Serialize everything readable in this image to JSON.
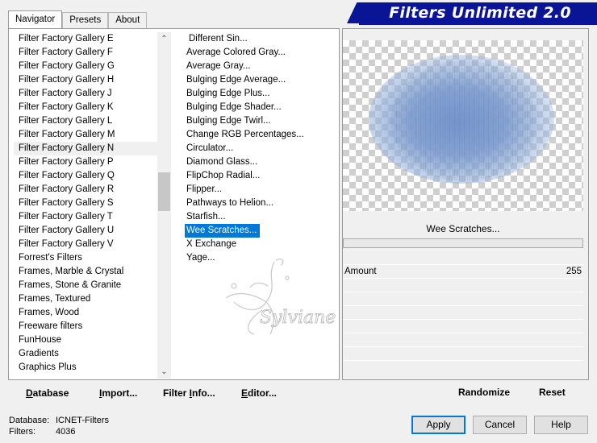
{
  "tabs": [
    {
      "label": "Navigator",
      "active": true
    },
    {
      "label": "Presets",
      "active": false
    },
    {
      "label": "About",
      "active": false
    }
  ],
  "app_title": "Filters Unlimited 2.0",
  "categories": [
    "Filter Factory Gallery E",
    "Filter Factory Gallery F",
    "Filter Factory Gallery G",
    "Filter Factory Gallery H",
    "Filter Factory Gallery J",
    "Filter Factory Gallery K",
    "Filter Factory Gallery L",
    "Filter Factory Gallery M",
    "Filter Factory Gallery N",
    "Filter Factory Gallery P",
    "Filter Factory Gallery Q",
    "Filter Factory Gallery R",
    "Filter Factory Gallery S",
    "Filter Factory Gallery T",
    "Filter Factory Gallery U",
    "Filter Factory Gallery V",
    "Forrest's Filters",
    "Frames, Marble & Crystal",
    "Frames, Stone & Granite",
    "Frames, Textured",
    "Frames, Wood",
    "Freeware filters",
    "FunHouse",
    "Gradients",
    "Graphics Plus"
  ],
  "selected_category": "Filter Factory Gallery N",
  "filters": [
    "Different Sin...",
    "Average Colored Gray...",
    "Average Gray...",
    "Bulging Edge Average...",
    "Bulging Edge Plus...",
    "Bulging Edge Shader...",
    "Bulging Edge Twirl...",
    "Change RGB Percentages...",
    "Circulator...",
    "Diamond Glass...",
    "FlipChop Radial...",
    "Flipper...",
    "Pathways to Helion...",
    "Starfish...",
    "Wee Scratches...",
    "X Exchange",
    "Yage..."
  ],
  "selected_filter": "Wee Scratches...",
  "signature_text": "Sylviane",
  "bottom_buttons": {
    "database": {
      "prefix": "D",
      "rest": "atabase"
    },
    "import": {
      "prefix": "I",
      "rest": "mport..."
    },
    "filter_info": {
      "before": "Filter ",
      "under": "I",
      "after": "nfo..."
    },
    "editor": {
      "prefix": "E",
      "rest": "ditor..."
    }
  },
  "preview": {
    "filter_name": "Wee Scratches...",
    "params": [
      {
        "label": "Amount",
        "value": "255"
      }
    ],
    "blob_color": "#8aa8d8"
  },
  "randomize_label": "Randomize",
  "reset_label": "Reset",
  "status": {
    "database_label": "Database:",
    "database_value": "ICNET-Filters",
    "filters_label": "Filters:",
    "filters_value": "4036"
  },
  "dialog_buttons": {
    "apply": "Apply",
    "cancel": "Cancel",
    "help": "Help"
  },
  "colors": {
    "banner": "#0a1596",
    "selection": "#0078d7"
  }
}
